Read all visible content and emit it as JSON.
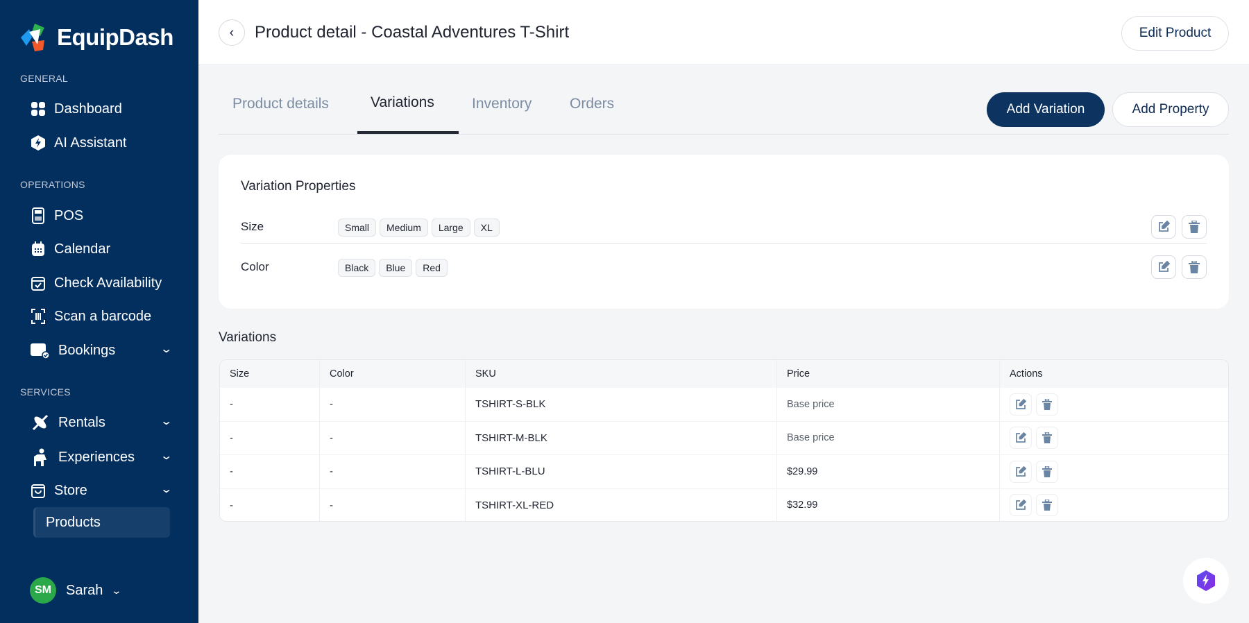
{
  "app": {
    "name": "EquipDash"
  },
  "sidebar": {
    "sections": {
      "general": "GENERAL",
      "operations": "OPERATIONS",
      "services": "SERVICES"
    },
    "items": {
      "dashboard": "Dashboard",
      "ai_assistant": "AI Assistant",
      "pos": "POS",
      "calendar": "Calendar",
      "check_availability": "Check Availability",
      "scan_barcode": "Scan a barcode",
      "bookings": "Bookings",
      "rentals": "Rentals",
      "experiences": "Experiences",
      "store": "Store",
      "products": "Products"
    },
    "user": {
      "initials": "SM",
      "name": "Sarah"
    }
  },
  "header": {
    "title": "Product detail - Coastal Adventures T-Shirt",
    "edit_label": "Edit Product"
  },
  "tabs": [
    "Product details",
    "Variations",
    "Inventory",
    "Orders"
  ],
  "actions": {
    "add_variation": "Add Variation",
    "add_property": "Add Property"
  },
  "properties": {
    "title": "Variation Properties",
    "rows": [
      {
        "name": "Size",
        "values": [
          "Small",
          "Medium",
          "Large",
          "XL"
        ]
      },
      {
        "name": "Color",
        "values": [
          "Black",
          "Blue",
          "Red"
        ]
      }
    ]
  },
  "variations": {
    "title": "Variations",
    "columns": [
      "Size",
      "Color",
      "SKU",
      "Price",
      "Actions"
    ],
    "rows": [
      {
        "size": "-",
        "color": "-",
        "sku": "TSHIRT-S-BLK",
        "price": "Base price"
      },
      {
        "size": "-",
        "color": "-",
        "sku": "TSHIRT-M-BLK",
        "price": "Base price"
      },
      {
        "size": "-",
        "color": "-",
        "sku": "TSHIRT-L-BLU",
        "price": "$29.99"
      },
      {
        "size": "-",
        "color": "-",
        "sku": "TSHIRT-XL-RED",
        "price": "$32.99"
      }
    ]
  },
  "colors": {
    "sidebar": "#032f5f",
    "primary": "#0d3461",
    "icon": "#6a85a3",
    "avatar": "#2aa84a",
    "ai": "#6a3df0"
  }
}
